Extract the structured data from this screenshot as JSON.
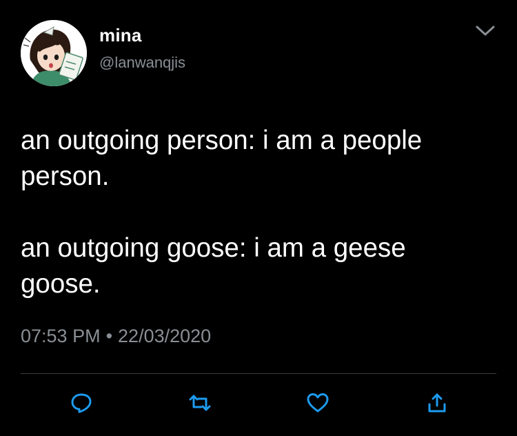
{
  "author": {
    "display_name": "mina",
    "handle": "@lanwanqjis"
  },
  "tweet": {
    "lines": [
      "an outgoing person: i am a people",
      "person.",
      "an outgoing goose: i am a geese",
      "goose."
    ],
    "time": "07:53 PM",
    "separator": "•",
    "date": "22/03/2020"
  },
  "actions": {
    "reply": "reply-icon",
    "retweet": "retweet-icon",
    "like": "heart-icon",
    "share": "share-icon"
  },
  "colors": {
    "background": "#000000",
    "text": "#ffffff",
    "muted": "#8a8f95",
    "divider": "#3a3d42"
  }
}
